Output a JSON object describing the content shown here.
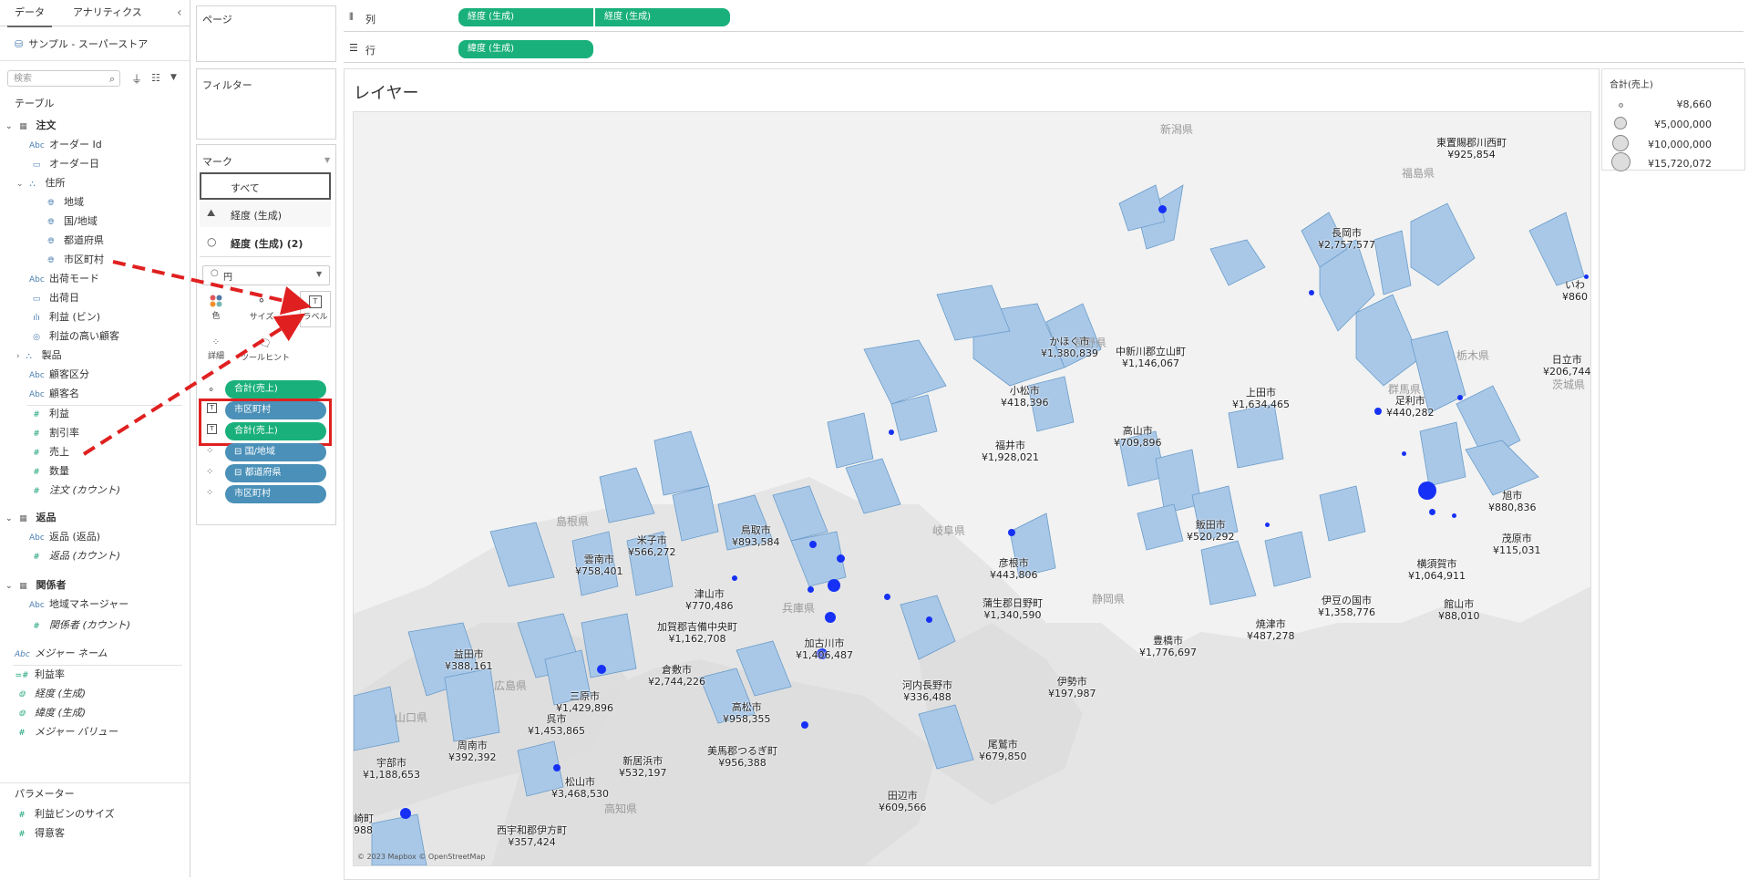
{
  "datapane": {
    "tabs": [
      "データ",
      "アナリティクス"
    ],
    "collapse_icon": "‹",
    "datasource": "サンプル - スーパーストア",
    "search_placeholder": "検索",
    "tables_header": "テーブル",
    "items": [
      {
        "label": "注文",
        "type": "table",
        "icon": "table-icon"
      },
      {
        "label": "オーダー Id",
        "type": "abc"
      },
      {
        "label": "オーダー日",
        "type": "date"
      },
      {
        "label": "住所",
        "type": "hierarchy"
      },
      {
        "label": "地域",
        "type": "geo"
      },
      {
        "label": "国/地域",
        "type": "geo"
      },
      {
        "label": "都道府県",
        "type": "geo"
      },
      {
        "label": "市区町村",
        "type": "geo"
      },
      {
        "label": "出荷モード",
        "type": "abc"
      },
      {
        "label": "出荷日",
        "type": "date"
      },
      {
        "label": "利益 (ビン)",
        "type": "bin"
      },
      {
        "label": "利益の高い顧客",
        "type": "set"
      },
      {
        "label": "製品",
        "type": "hierarchy"
      },
      {
        "label": "顧客区分",
        "type": "abc"
      },
      {
        "label": "顧客名",
        "type": "abc"
      },
      {
        "label": "利益",
        "type": "measure"
      },
      {
        "label": "割引率",
        "type": "measure"
      },
      {
        "label": "売上",
        "type": "measure"
      },
      {
        "label": "数量",
        "type": "measure"
      },
      {
        "label": "注文 (カウント)",
        "type": "measure"
      },
      {
        "label": "返品",
        "type": "table"
      },
      {
        "label": "返品 (返品)",
        "type": "abc"
      },
      {
        "label": "返品 (カウント)",
        "type": "measure"
      },
      {
        "label": "関係者",
        "type": "table"
      },
      {
        "label": "地域マネージャー",
        "type": "abc"
      },
      {
        "label": "関係者 (カウント)",
        "type": "measure"
      },
      {
        "label": "メジャー ネーム",
        "type": "abc"
      },
      {
        "label": "利益率",
        "type": "measure"
      },
      {
        "label": "経度 (生成)",
        "type": "geo"
      },
      {
        "label": "緯度 (生成)",
        "type": "geo"
      },
      {
        "label": "メジャー バリュー",
        "type": "measure"
      }
    ],
    "parameters_header": "パラメーター",
    "parameters": [
      "利益ビンのサイズ",
      "得意客"
    ]
  },
  "shelves": {
    "pages": "ページ",
    "filters": "フィルター",
    "columns_label": "列",
    "rows_label": "行",
    "columns": [
      "経度 (生成)",
      "経度 (生成)"
    ],
    "rows": [
      "緯度 (生成)"
    ]
  },
  "marks": {
    "title": "マーク",
    "all": "すべて",
    "layer1": "経度 (生成)",
    "layer2": "経度 (生成) (2)",
    "mark_type": "円",
    "buttons": [
      "色",
      "サイズ",
      "ラベル",
      "詳細",
      "ツールヒント"
    ],
    "fields": [
      {
        "label": "合計(売上)",
        "color": "green",
        "icon": "size"
      },
      {
        "label": "市区町村",
        "color": "blue",
        "icon": "label"
      },
      {
        "label": "合計(売上)",
        "color": "green",
        "icon": "label"
      },
      {
        "label": "国/地域",
        "color": "blue",
        "icon": "detail",
        "prefix": "⊟ "
      },
      {
        "label": "都道府県",
        "color": "blue",
        "icon": "detail",
        "prefix": "⊟ "
      },
      {
        "label": "市区町村",
        "color": "blue",
        "icon": "detail"
      }
    ]
  },
  "viz": {
    "title": "レイヤー",
    "attribution": "© 2023 Mapbox © OpenStreetMap",
    "prefectures": [
      "新潟県",
      "福島県",
      "長野県",
      "栃木県",
      "群馬県",
      "茨城県",
      "岐阜県",
      "静岡県",
      "島根県",
      "広島県",
      "山口県",
      "高知県",
      "兵庫県"
    ],
    "cities": [
      {
        "name": "東置賜郡川西町",
        "value": "¥925,854"
      },
      {
        "name": "長岡市",
        "value": "¥2,757,577"
      },
      {
        "name": "いわ",
        "value": "¥860"
      },
      {
        "name": "日立市",
        "value": "¥206,744"
      },
      {
        "name": "かほく市",
        "value": "¥1,380,839"
      },
      {
        "name": "中新川郡立山町",
        "value": "¥1,146,067"
      },
      {
        "name": "上田市",
        "value": "¥1,634,465"
      },
      {
        "name": "足利市",
        "value": "¥440,282"
      },
      {
        "name": "小松市",
        "value": "¥418,396"
      },
      {
        "name": "高山市",
        "value": "¥709,896"
      },
      {
        "name": "福井市",
        "value": "¥1,928,021"
      },
      {
        "name": "旭市",
        "value": "¥880,836"
      },
      {
        "name": "米子市",
        "value": "¥566,272"
      },
      {
        "name": "鳥取市",
        "value": "¥893,584"
      },
      {
        "name": "飯田市",
        "value": "¥520,292"
      },
      {
        "name": "雲南市",
        "value": "¥758,401"
      },
      {
        "name": "彦根市",
        "value": "¥443,806"
      },
      {
        "name": "茂原市",
        "value": "¥115,031"
      },
      {
        "name": "横須賀市",
        "value": "¥1,064,911"
      },
      {
        "name": "津山市",
        "value": "¥770,486"
      },
      {
        "name": "蒲生郡日野町",
        "value": "¥1,340,590"
      },
      {
        "name": "伊豆の国市",
        "value": "¥1,358,776"
      },
      {
        "name": "館山市",
        "value": "¥88,010"
      },
      {
        "name": "加賀郡吉備中央町",
        "value": "¥1,162,708"
      },
      {
        "name": "加古川市",
        "value": "¥1,406,487"
      },
      {
        "name": "焼津市",
        "value": "¥487,278"
      },
      {
        "name": "豊橋市",
        "value": "¥1,776,697"
      },
      {
        "name": "益田市",
        "value": "¥388,161"
      },
      {
        "name": "倉敷市",
        "value": "¥2,744,226"
      },
      {
        "name": "三原市",
        "value": "¥1,429,896"
      },
      {
        "name": "伊勢市",
        "value": "¥197,987"
      },
      {
        "name": "高松市",
        "value": "¥958,355"
      },
      {
        "name": "河内長野市",
        "value": "¥336,488"
      },
      {
        "name": "呉市",
        "value": "¥1,453,865"
      },
      {
        "name": "周南市",
        "value": "¥392,392"
      },
      {
        "name": "宇部市",
        "value": "¥1,188,653"
      },
      {
        "name": "美馬郡つるぎ町",
        "value": "¥956,388"
      },
      {
        "name": "新居浜市",
        "value": "¥532,197"
      },
      {
        "name": "尾鷲市",
        "value": "¥679,850"
      },
      {
        "name": "松山市",
        "value": "¥3,468,530"
      },
      {
        "name": "田辺市",
        "value": "¥609,566"
      },
      {
        "name": "崎町",
        "value": "988"
      },
      {
        "name": "西宇和郡伊方町",
        "value": "¥357,424"
      }
    ]
  },
  "legend": {
    "title": "合計(売上)",
    "entries": [
      "¥8,660",
      "¥5,000,000",
      "¥10,000,000",
      "¥15,720,072"
    ]
  }
}
